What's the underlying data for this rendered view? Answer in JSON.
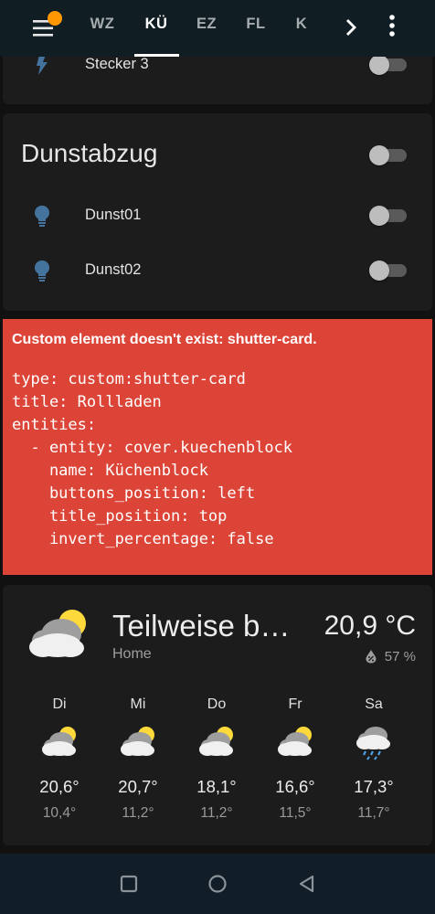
{
  "header": {
    "tabs": [
      {
        "label": "WZ"
      },
      {
        "label": "KÜ",
        "active": true
      },
      {
        "label": "EZ"
      },
      {
        "label": "FL"
      },
      {
        "label": "K"
      }
    ],
    "accent_color": "#ff9800"
  },
  "top_card": {
    "rows": [
      {
        "name": "Stecker 3",
        "icon": "flash-icon",
        "on": false
      }
    ]
  },
  "dunstabzug_card": {
    "title": "Dunstabzug",
    "on": false,
    "rows": [
      {
        "name": "Dunst01",
        "icon": "lightbulb-icon",
        "on": false
      },
      {
        "name": "Dunst02",
        "icon": "lightbulb-icon",
        "on": false
      }
    ]
  },
  "error_card": {
    "title": "Custom element doesn't exist: shutter-card.",
    "code": "type: custom:shutter-card\ntitle: Rollladen\nentities:\n  - entity: cover.kuechenblock\n    name: Küchenblock\n    buttons_position: left\n    title_position: top\n    invert_percentage: false",
    "color": "#db4437"
  },
  "weather": {
    "state": "Teilweise b…",
    "name": "Home",
    "temperature": "20,9 °C",
    "humidity": "57 %",
    "icon": "partly-cloudy-icon",
    "forecast": [
      {
        "day": "Di",
        "high": "20,6°",
        "low": "10,4°",
        "icon": "partly-cloudy-icon"
      },
      {
        "day": "Mi",
        "high": "20,7°",
        "low": "11,2°",
        "icon": "partly-cloudy-icon"
      },
      {
        "day": "Do",
        "high": "18,1°",
        "low": "11,2°",
        "icon": "partly-cloudy-icon"
      },
      {
        "day": "Fr",
        "high": "16,6°",
        "low": "11,5°",
        "icon": "partly-cloudy-icon"
      },
      {
        "day": "Sa",
        "high": "17,3°",
        "low": "11,7°",
        "icon": "rainy-icon"
      }
    ]
  },
  "navbar": {
    "buttons": [
      "recents-icon",
      "home-icon",
      "back-icon"
    ]
  }
}
